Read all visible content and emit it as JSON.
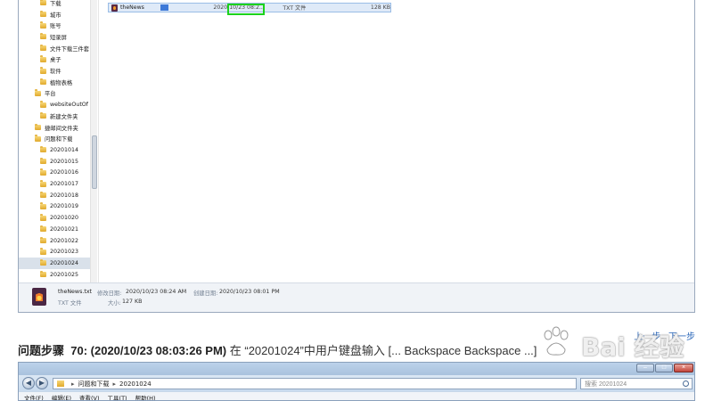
{
  "explorer_top": {
    "nav_items": [
      {
        "label": "下载",
        "indent": 1
      },
      {
        "label": "城市",
        "indent": 1
      },
      {
        "label": "账号",
        "indent": 1
      },
      {
        "label": "短录屏",
        "indent": 1
      },
      {
        "label": "文件下载三件套",
        "indent": 1
      },
      {
        "label": "桌子",
        "indent": 1
      },
      {
        "label": "软件",
        "indent": 1
      },
      {
        "label": "植物表格",
        "indent": 1
      },
      {
        "label": "平台",
        "indent": 0
      },
      {
        "label": "websiteOutOf",
        "indent": 1
      },
      {
        "label": "新建文件夹",
        "indent": 1
      },
      {
        "label": "捷邮间文件夹",
        "indent": 0
      },
      {
        "label": "问题和下载",
        "indent": 0
      },
      {
        "label": "20201014",
        "indent": 1
      },
      {
        "label": "20201015",
        "indent": 1
      },
      {
        "label": "20201016",
        "indent": 1
      },
      {
        "label": "20201017",
        "indent": 1
      },
      {
        "label": "20201018",
        "indent": 1
      },
      {
        "label": "20201019",
        "indent": 1
      },
      {
        "label": "20201020",
        "indent": 1
      },
      {
        "label": "20201021",
        "indent": 1
      },
      {
        "label": "20201022",
        "indent": 1
      },
      {
        "label": "20201023",
        "indent": 1
      },
      {
        "label": "20201024",
        "indent": 1,
        "selected": true
      },
      {
        "label": "20201025",
        "indent": 1
      }
    ],
    "file": {
      "name_editing": "theNews",
      "date": "2020/10/23 08:2...",
      "type": "TXT 文件",
      "size": "128 KB"
    },
    "details": {
      "filename": "theNews.txt",
      "modified_label": "修改日期:",
      "modified_value": "2020/10/23 08:24 AM",
      "created_label": "创建日期:",
      "created_value": "2020/10/23 08:01 PM",
      "type": "TXT 文件",
      "size_label": "大小:",
      "size_value": "127 KB"
    }
  },
  "pager": {
    "prev": "上一步",
    "next": "下一步"
  },
  "step": {
    "prefix": "问题步骤",
    "number_time": "70: (2020/10/23 08:03:26 PM)",
    "text": "在 “20201024”中用户键盘输入 [... Backspace Backspace ...]"
  },
  "watermark": {
    "brand": "Bai 经验",
    "url": "jingyan.baidu.com"
  },
  "explorer_bottom": {
    "breadcrumb": [
      "问题和下载",
      "20201024"
    ],
    "search_placeholder": "搜索 20201024",
    "menu": [
      "文件(F)",
      "编辑(E)",
      "查看(V)",
      "工具(T)",
      "帮助(H)"
    ],
    "window_buttons": {
      "min": "–",
      "max": "□",
      "close": "×"
    }
  }
}
